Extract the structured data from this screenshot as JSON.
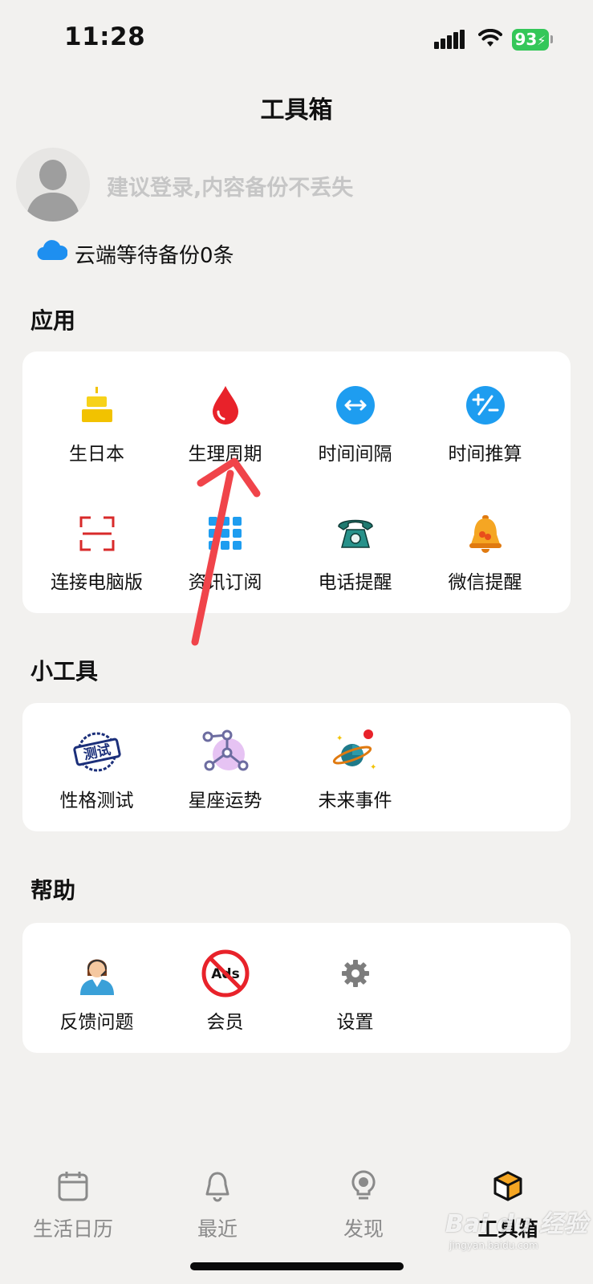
{
  "status_bar": {
    "time": "11:28",
    "battery": "93"
  },
  "page_title": "工具箱",
  "profile": {
    "login_hint": "建议登录,内容备份不丢失",
    "backup_text": "云端等待备份0条"
  },
  "sections": {
    "apps": {
      "title": "应用",
      "items": [
        {
          "label": "生日本",
          "icon": "birthday-cake-icon"
        },
        {
          "label": "生理周期",
          "icon": "blood-drop-icon"
        },
        {
          "label": "时间间隔",
          "icon": "time-interval-icon"
        },
        {
          "label": "时间推算",
          "icon": "time-calc-icon"
        },
        {
          "label": "连接电脑版",
          "icon": "scan-frame-icon"
        },
        {
          "label": "资讯订阅",
          "icon": "grid-icon"
        },
        {
          "label": "电话提醒",
          "icon": "telephone-icon"
        },
        {
          "label": "微信提醒",
          "icon": "bell-icon"
        }
      ]
    },
    "tools": {
      "title": "小工具",
      "items": [
        {
          "label": "性格测试",
          "icon": "test-stamp-icon",
          "stamp_text": "测试"
        },
        {
          "label": "星座运势",
          "icon": "constellation-icon"
        },
        {
          "label": "未来事件",
          "icon": "planet-icon"
        }
      ]
    },
    "help": {
      "title": "帮助",
      "items": [
        {
          "label": "反馈问题",
          "icon": "support-agent-icon"
        },
        {
          "label": "会员",
          "icon": "no-ads-icon",
          "badge_text": "Ads"
        },
        {
          "label": "设置",
          "icon": "gear-icon"
        }
      ]
    }
  },
  "bottom_nav": [
    {
      "label": "生活日历",
      "icon": "calendar-icon",
      "active": false
    },
    {
      "label": "最近",
      "icon": "bell-outline-icon",
      "active": false
    },
    {
      "label": "发现",
      "icon": "lightbulb-icon",
      "active": false
    },
    {
      "label": "工具箱",
      "icon": "cube-icon",
      "active": true
    }
  ],
  "watermark": {
    "text": "Bai du 经验",
    "sub": "jingyan.baidu.com"
  },
  "colors": {
    "background": "#f2f1ef",
    "card": "#ffffff",
    "accent_blue": "#1e9df0",
    "accent_red": "#e8222a",
    "annotation_arrow": "#f0444a"
  }
}
